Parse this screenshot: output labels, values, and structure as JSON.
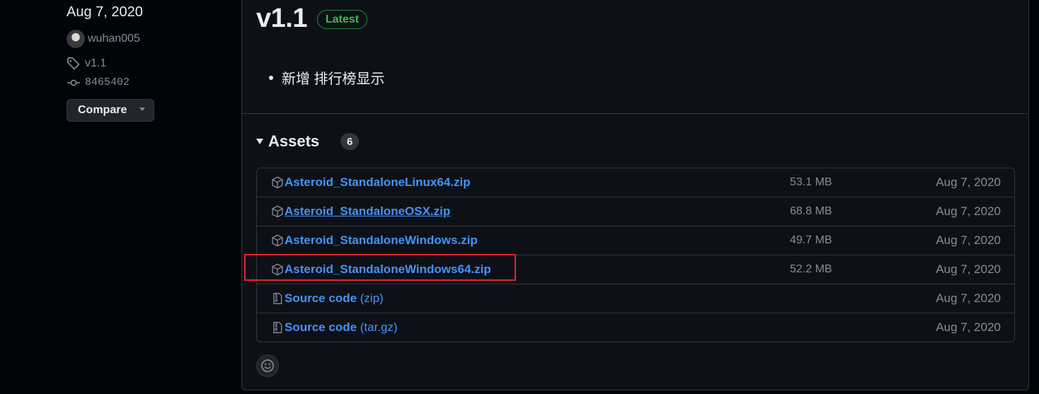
{
  "sidebar": {
    "date": "Aug 7, 2020",
    "author": "wuhan005",
    "tag": "v1.1",
    "commit": "8465402",
    "compare_label": "Compare"
  },
  "release": {
    "title": "v1.1",
    "badge": "Latest",
    "notes": [
      "新增 排行榜显示"
    ]
  },
  "assets": {
    "heading": "Assets",
    "count": "6",
    "items": [
      {
        "name": "Asteroid_StandaloneLinux64.zip",
        "suffix": "",
        "size": "53.1 MB",
        "date": "Aug 7, 2020",
        "icon": "package-icon"
      },
      {
        "name": "Asteroid_StandaloneOSX.zip",
        "suffix": "",
        "size": "68.8 MB",
        "date": "Aug 7, 2020",
        "icon": "package-icon"
      },
      {
        "name": "Asteroid_StandaloneWindows.zip",
        "suffix": "",
        "size": "49.7 MB",
        "date": "Aug 7, 2020",
        "icon": "package-icon"
      },
      {
        "name": "Asteroid_StandaloneWindows64.zip",
        "suffix": "",
        "size": "52.2 MB",
        "date": "Aug 7, 2020",
        "icon": "package-icon"
      },
      {
        "name": "Source code",
        "suffix": " (zip)",
        "size": "",
        "date": "Aug 7, 2020",
        "icon": "file-zip-icon"
      },
      {
        "name": "Source code",
        "suffix": " (tar.gz)",
        "size": "",
        "date": "Aug 7, 2020",
        "icon": "file-zip-icon"
      }
    ]
  },
  "colors": {
    "accent_link": "#4493f8",
    "latest_green": "#3fb950",
    "highlight_red": "#e0262b"
  }
}
